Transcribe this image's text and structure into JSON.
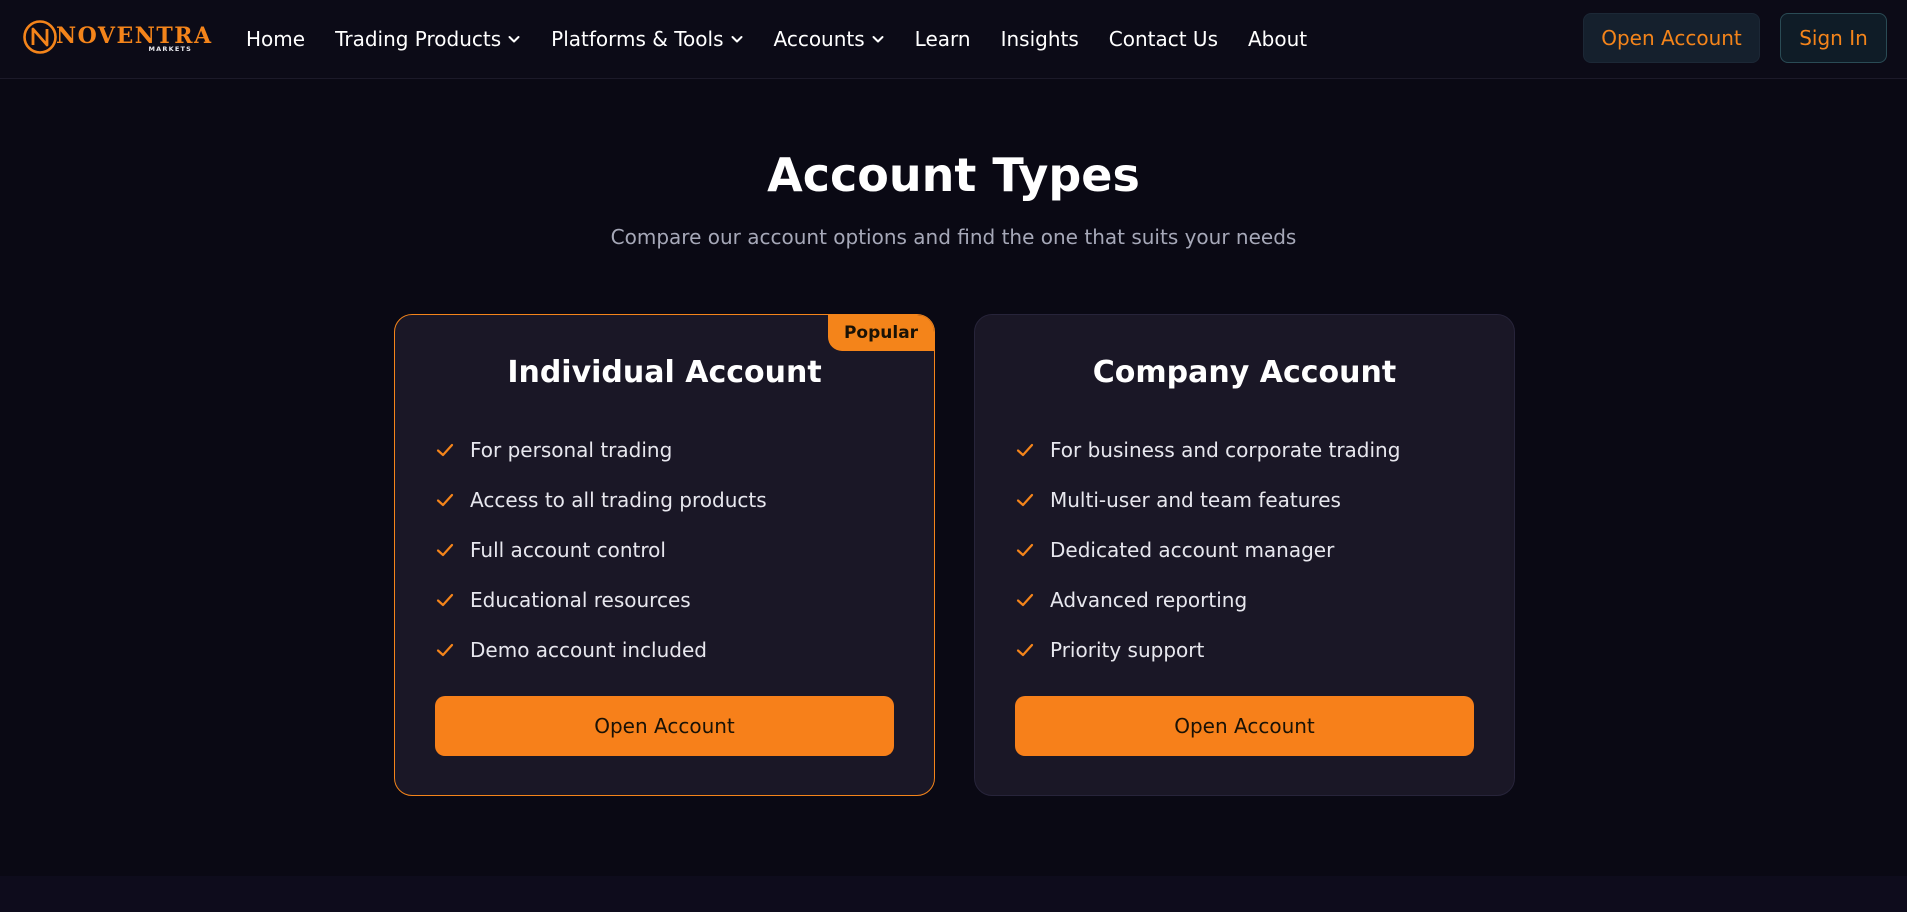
{
  "brand": {
    "name": "NOVENTRA",
    "tagline": "MARKETS",
    "accent": "#f4841a"
  },
  "nav": {
    "items": [
      {
        "label": "Home",
        "dropdown": false
      },
      {
        "label": "Trading Products",
        "dropdown": true
      },
      {
        "label": "Platforms & Tools",
        "dropdown": true
      },
      {
        "label": "Accounts",
        "dropdown": true
      },
      {
        "label": "Learn",
        "dropdown": false
      },
      {
        "label": "Insights",
        "dropdown": false
      },
      {
        "label": "Contact Us",
        "dropdown": false
      },
      {
        "label": "About",
        "dropdown": false
      }
    ],
    "open_account_label": "Open Account",
    "sign_in_label": "Sign In"
  },
  "section": {
    "title": "Account Types",
    "subtitle": "Compare our account options and find the one that suits your needs"
  },
  "cards": [
    {
      "title": "Individual Account",
      "badge": "Popular",
      "features": [
        "For personal trading",
        "Access to all trading products",
        "Full account control",
        "Educational resources",
        "Demo account included"
      ],
      "button_label": "Open Account"
    },
    {
      "title": "Company Account",
      "badge": "",
      "features": [
        "For business and corporate trading",
        "Multi-user and team features",
        "Dedicated account manager",
        "Advanced reporting",
        "Priority support"
      ],
      "button_label": "Open Account"
    }
  ],
  "icons": {
    "logo": "noventra-logo-icon",
    "dropdown": "chevron-down-icon",
    "feature": "check-icon"
  },
  "colors": {
    "background": "#0a0914",
    "card": "#1a1726",
    "accent": "#f4841a",
    "muted_text": "#a6a8b8"
  }
}
